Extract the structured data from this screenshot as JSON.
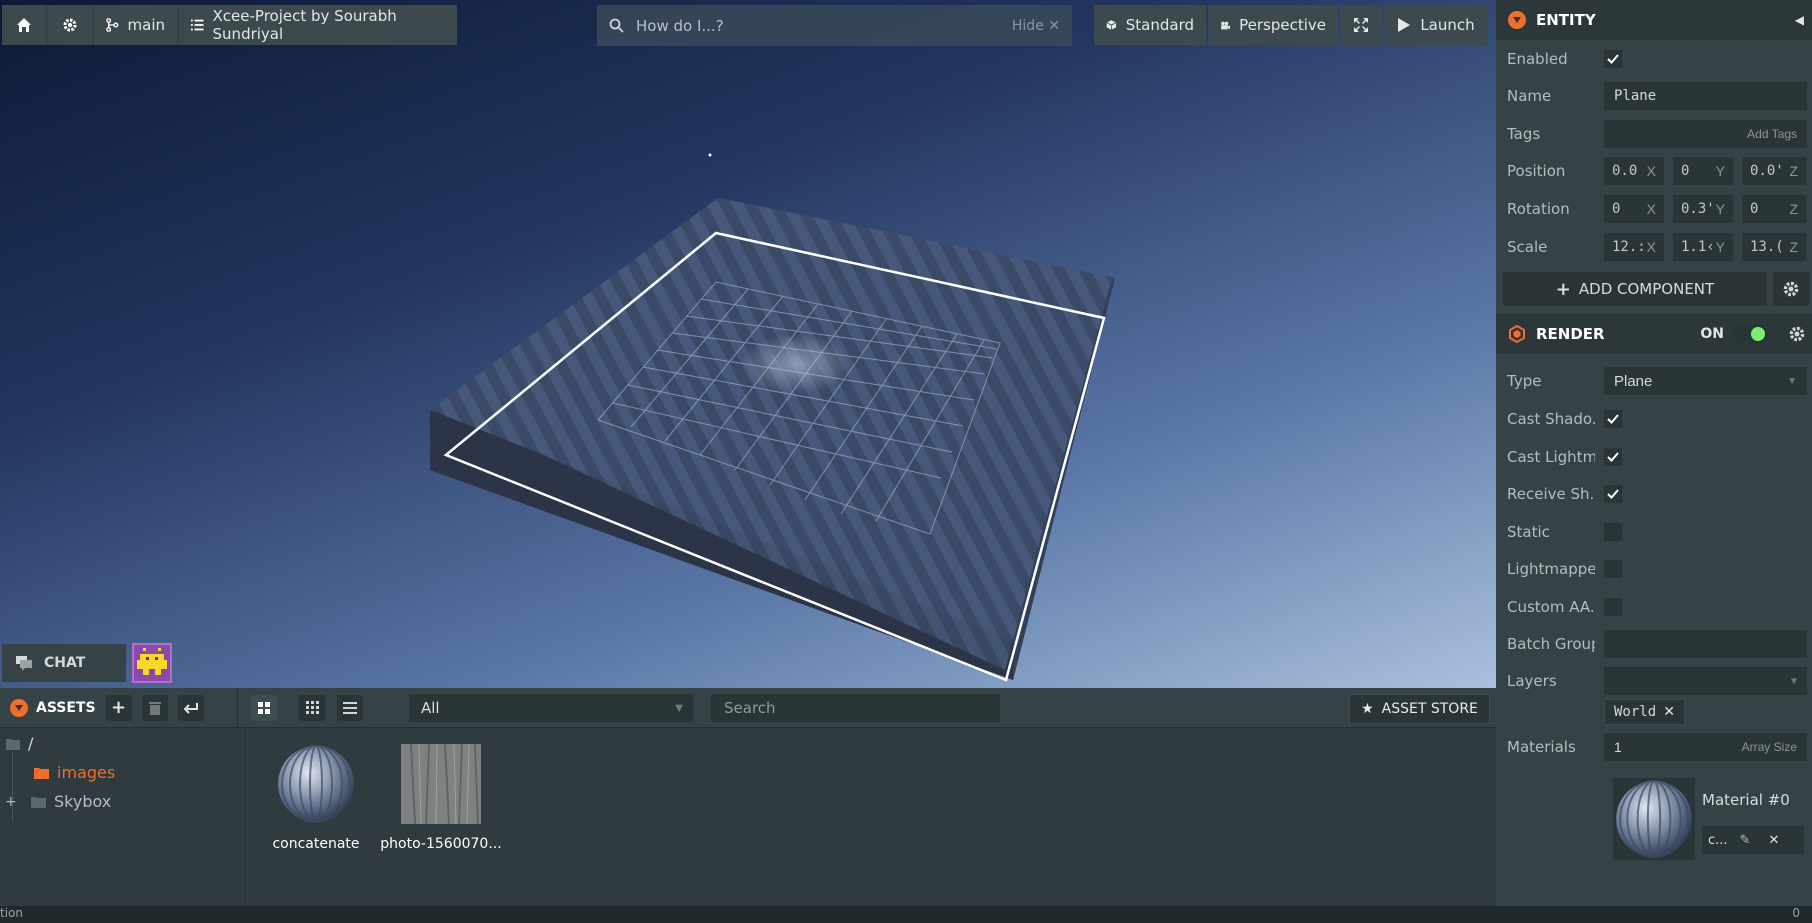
{
  "toolbar": {
    "branch": "main",
    "project": "Xcee-Project by Sourabh Sundriyal",
    "search_placeholder": "How do I...?",
    "hide_label": "Hide",
    "standard_label": "Standard",
    "perspective_label": "Perspective",
    "launch_label": "Launch"
  },
  "chat": {
    "label": "CHAT"
  },
  "assets": {
    "title": "ASSETS",
    "filter_value": "All",
    "search_placeholder": "Search",
    "store_label": "ASSET STORE",
    "tree": {
      "root": "/",
      "images": "images",
      "skybox": "Skybox"
    },
    "items": [
      {
        "name": "concatenate",
        "icon": "material-sphere-icon"
      },
      {
        "name": "photo-1560070...",
        "icon": "texture-icon"
      }
    ]
  },
  "status": {
    "left": "tion",
    "right": "0"
  },
  "entity": {
    "title": "ENTITY",
    "enabled_label": "Enabled",
    "name_label": "Name",
    "name_value": "Plane",
    "tags_label": "Tags",
    "tags_placeholder": "Add Tags",
    "position_label": "Position",
    "rotation_label": "Rotation",
    "scale_label": "Scale",
    "position": [
      "0.0",
      "0",
      "0.0'"
    ],
    "rotation": [
      "0",
      "0.3'",
      "0"
    ],
    "scale": [
      "12.:",
      "1.1‹",
      "13.("
    ],
    "axes": [
      "X",
      "Y",
      "Z"
    ],
    "add_component_label": "ADD COMPONENT"
  },
  "render": {
    "title": "RENDER",
    "on_label": "ON",
    "type_label": "Type",
    "type_value": "Plane",
    "cast_shadows_label": "Cast Shado...",
    "cast_lightmap_label": "Cast Lightm...",
    "receive_shadows_label": "Receive Sh...",
    "static_label": "Static",
    "lightmapped_label": "Lightmapped",
    "custom_aa_label": "Custom AA...",
    "batch_group_label": "Batch Group",
    "layers_label": "Layers",
    "layer_tag": "World",
    "materials_label": "Materials",
    "materials_count": "1",
    "array_size_label": "Array Size",
    "material_name": "Material #0",
    "material_short": "c..."
  },
  "colors": {
    "accent": "#f06d2c",
    "toggle_on": "#7cf06c",
    "panel": "#364346"
  }
}
